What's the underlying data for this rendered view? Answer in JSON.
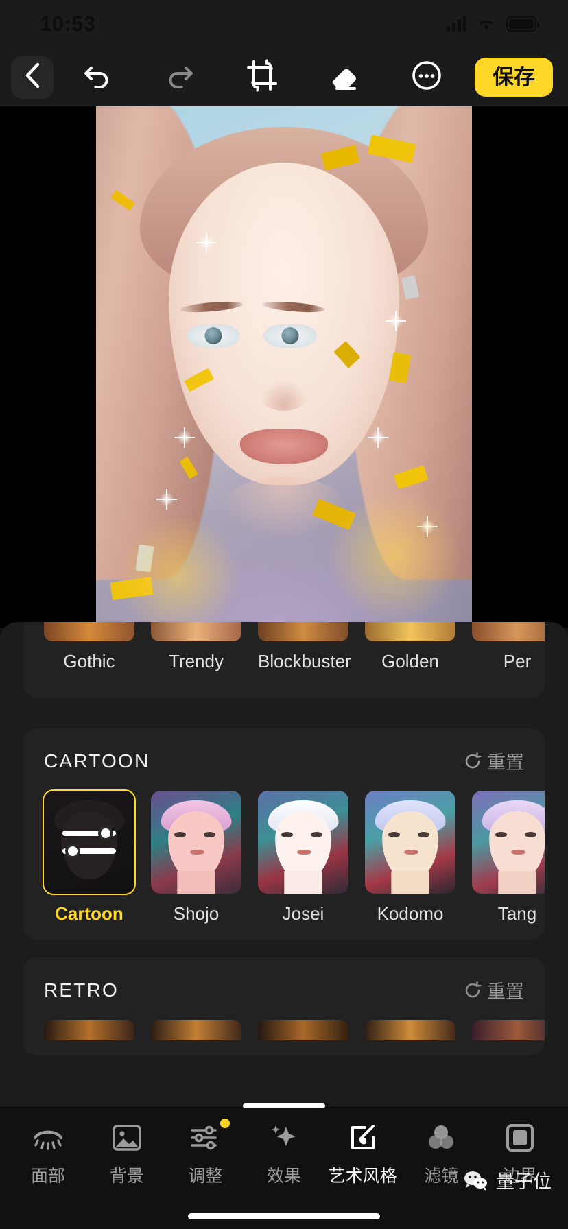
{
  "status_bar": {
    "time": "10:53",
    "signal_icon": "cellular-signal-icon",
    "wifi_icon": "wifi-icon",
    "battery_icon": "battery-icon"
  },
  "toolbar": {
    "back_icon": "chevron-left-icon",
    "undo_icon": "undo-icon",
    "redo_icon": "redo-icon",
    "crop_icon": "crop-rotate-icon",
    "eraser_icon": "eraser-icon",
    "more_icon": "more-options-icon",
    "save_label": "保存",
    "save_color": "#ffd727"
  },
  "canvas": {
    "name": "photo-preview"
  },
  "sheet": {
    "top_section": {
      "items": [
        {
          "label": "Gothic"
        },
        {
          "label": "Trendy"
        },
        {
          "label": "Blockbuster"
        },
        {
          "label": "Golden"
        },
        {
          "label": "Per"
        }
      ]
    },
    "cartoon_section": {
      "title": "CARTOON",
      "reset_label": "重置",
      "reset_icon": "reset-arrow-icon",
      "items": [
        {
          "label": "Cartoon",
          "selected": true
        },
        {
          "label": "Shojo",
          "selected": false
        },
        {
          "label": "Josei",
          "selected": false
        },
        {
          "label": "Kodomo",
          "selected": false
        },
        {
          "label": "Tang",
          "selected": false
        }
      ]
    },
    "retro_section": {
      "title": "RETRO",
      "reset_label": "重置",
      "reset_icon": "reset-arrow-icon"
    }
  },
  "nav": {
    "items": [
      {
        "label": "面部",
        "icon": "eye-lashes-icon",
        "active": false,
        "badge": false
      },
      {
        "label": "背景",
        "icon": "image-icon",
        "active": false,
        "badge": false
      },
      {
        "label": "调整",
        "icon": "sliders-icon",
        "active": false,
        "badge": true
      },
      {
        "label": "效果",
        "icon": "sparkles-icon",
        "active": false,
        "badge": false
      },
      {
        "label": "艺术风格",
        "icon": "art-brush-icon",
        "active": true,
        "badge": false
      },
      {
        "label": "滤镜",
        "icon": "filter-circles-icon",
        "active": false,
        "badge": false
      },
      {
        "label": "边界",
        "icon": "border-square-icon",
        "active": false,
        "badge": false
      }
    ]
  },
  "watermark": {
    "text": "量子位",
    "icon": "wechat-icon"
  }
}
